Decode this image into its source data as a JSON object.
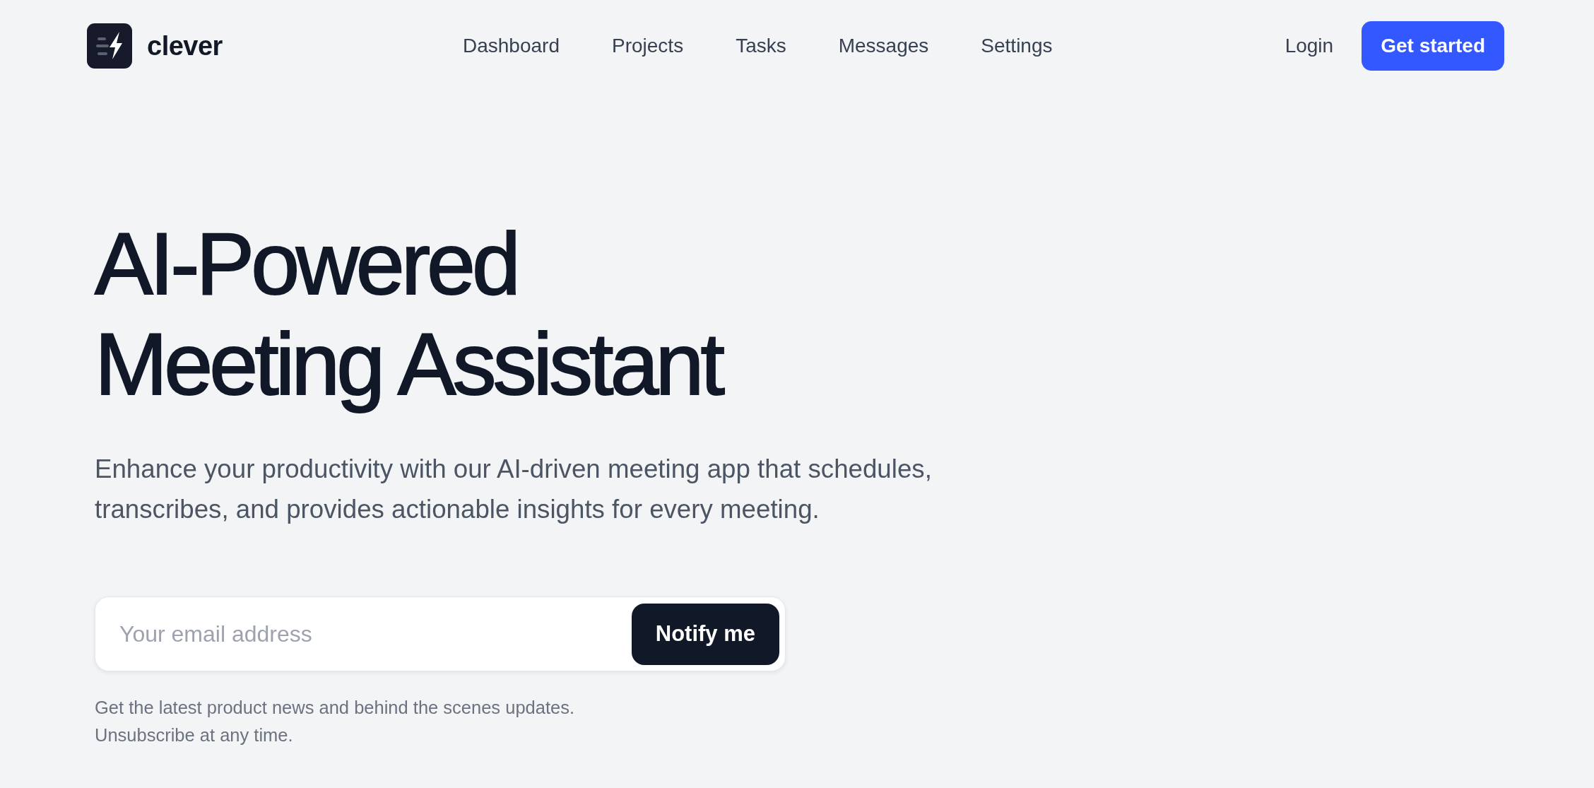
{
  "header": {
    "logo": {
      "name": "clever"
    },
    "nav": [
      {
        "label": "Dashboard"
      },
      {
        "label": "Projects"
      },
      {
        "label": "Tasks"
      },
      {
        "label": "Messages"
      },
      {
        "label": "Settings"
      }
    ],
    "login": "Login",
    "cta": "Get started"
  },
  "hero": {
    "title": "AI-Powered Meeting Assistant",
    "description": "Enhance your productivity with our AI-driven meeting app that schedules, transcribes, and provides actionable insights for every meeting.",
    "signup": {
      "placeholder": "Your email address",
      "button": "Notify me"
    },
    "note_lines": [
      "Get the latest product news and behind the scenes updates.",
      "Unsubscribe at any time."
    ]
  }
}
